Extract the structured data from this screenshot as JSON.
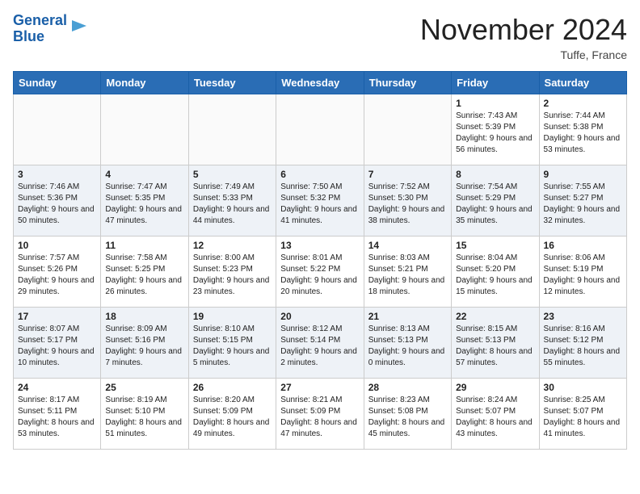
{
  "header": {
    "logo_line1": "General",
    "logo_line2": "Blue",
    "month": "November 2024",
    "location": "Tuffe, France"
  },
  "weekdays": [
    "Sunday",
    "Monday",
    "Tuesday",
    "Wednesday",
    "Thursday",
    "Friday",
    "Saturday"
  ],
  "weeks": [
    [
      {
        "day": "",
        "info": ""
      },
      {
        "day": "",
        "info": ""
      },
      {
        "day": "",
        "info": ""
      },
      {
        "day": "",
        "info": ""
      },
      {
        "day": "",
        "info": ""
      },
      {
        "day": "1",
        "info": "Sunrise: 7:43 AM\nSunset: 5:39 PM\nDaylight: 9 hours and 56 minutes."
      },
      {
        "day": "2",
        "info": "Sunrise: 7:44 AM\nSunset: 5:38 PM\nDaylight: 9 hours and 53 minutes."
      }
    ],
    [
      {
        "day": "3",
        "info": "Sunrise: 7:46 AM\nSunset: 5:36 PM\nDaylight: 9 hours and 50 minutes."
      },
      {
        "day": "4",
        "info": "Sunrise: 7:47 AM\nSunset: 5:35 PM\nDaylight: 9 hours and 47 minutes."
      },
      {
        "day": "5",
        "info": "Sunrise: 7:49 AM\nSunset: 5:33 PM\nDaylight: 9 hours and 44 minutes."
      },
      {
        "day": "6",
        "info": "Sunrise: 7:50 AM\nSunset: 5:32 PM\nDaylight: 9 hours and 41 minutes."
      },
      {
        "day": "7",
        "info": "Sunrise: 7:52 AM\nSunset: 5:30 PM\nDaylight: 9 hours and 38 minutes."
      },
      {
        "day": "8",
        "info": "Sunrise: 7:54 AM\nSunset: 5:29 PM\nDaylight: 9 hours and 35 minutes."
      },
      {
        "day": "9",
        "info": "Sunrise: 7:55 AM\nSunset: 5:27 PM\nDaylight: 9 hours and 32 minutes."
      }
    ],
    [
      {
        "day": "10",
        "info": "Sunrise: 7:57 AM\nSunset: 5:26 PM\nDaylight: 9 hours and 29 minutes."
      },
      {
        "day": "11",
        "info": "Sunrise: 7:58 AM\nSunset: 5:25 PM\nDaylight: 9 hours and 26 minutes."
      },
      {
        "day": "12",
        "info": "Sunrise: 8:00 AM\nSunset: 5:23 PM\nDaylight: 9 hours and 23 minutes."
      },
      {
        "day": "13",
        "info": "Sunrise: 8:01 AM\nSunset: 5:22 PM\nDaylight: 9 hours and 20 minutes."
      },
      {
        "day": "14",
        "info": "Sunrise: 8:03 AM\nSunset: 5:21 PM\nDaylight: 9 hours and 18 minutes."
      },
      {
        "day": "15",
        "info": "Sunrise: 8:04 AM\nSunset: 5:20 PM\nDaylight: 9 hours and 15 minutes."
      },
      {
        "day": "16",
        "info": "Sunrise: 8:06 AM\nSunset: 5:19 PM\nDaylight: 9 hours and 12 minutes."
      }
    ],
    [
      {
        "day": "17",
        "info": "Sunrise: 8:07 AM\nSunset: 5:17 PM\nDaylight: 9 hours and 10 minutes."
      },
      {
        "day": "18",
        "info": "Sunrise: 8:09 AM\nSunset: 5:16 PM\nDaylight: 9 hours and 7 minutes."
      },
      {
        "day": "19",
        "info": "Sunrise: 8:10 AM\nSunset: 5:15 PM\nDaylight: 9 hours and 5 minutes."
      },
      {
        "day": "20",
        "info": "Sunrise: 8:12 AM\nSunset: 5:14 PM\nDaylight: 9 hours and 2 minutes."
      },
      {
        "day": "21",
        "info": "Sunrise: 8:13 AM\nSunset: 5:13 PM\nDaylight: 9 hours and 0 minutes."
      },
      {
        "day": "22",
        "info": "Sunrise: 8:15 AM\nSunset: 5:13 PM\nDaylight: 8 hours and 57 minutes."
      },
      {
        "day": "23",
        "info": "Sunrise: 8:16 AM\nSunset: 5:12 PM\nDaylight: 8 hours and 55 minutes."
      }
    ],
    [
      {
        "day": "24",
        "info": "Sunrise: 8:17 AM\nSunset: 5:11 PM\nDaylight: 8 hours and 53 minutes."
      },
      {
        "day": "25",
        "info": "Sunrise: 8:19 AM\nSunset: 5:10 PM\nDaylight: 8 hours and 51 minutes."
      },
      {
        "day": "26",
        "info": "Sunrise: 8:20 AM\nSunset: 5:09 PM\nDaylight: 8 hours and 49 minutes."
      },
      {
        "day": "27",
        "info": "Sunrise: 8:21 AM\nSunset: 5:09 PM\nDaylight: 8 hours and 47 minutes."
      },
      {
        "day": "28",
        "info": "Sunrise: 8:23 AM\nSunset: 5:08 PM\nDaylight: 8 hours and 45 minutes."
      },
      {
        "day": "29",
        "info": "Sunrise: 8:24 AM\nSunset: 5:07 PM\nDaylight: 8 hours and 43 minutes."
      },
      {
        "day": "30",
        "info": "Sunrise: 8:25 AM\nSunset: 5:07 PM\nDaylight: 8 hours and 41 minutes."
      }
    ]
  ]
}
